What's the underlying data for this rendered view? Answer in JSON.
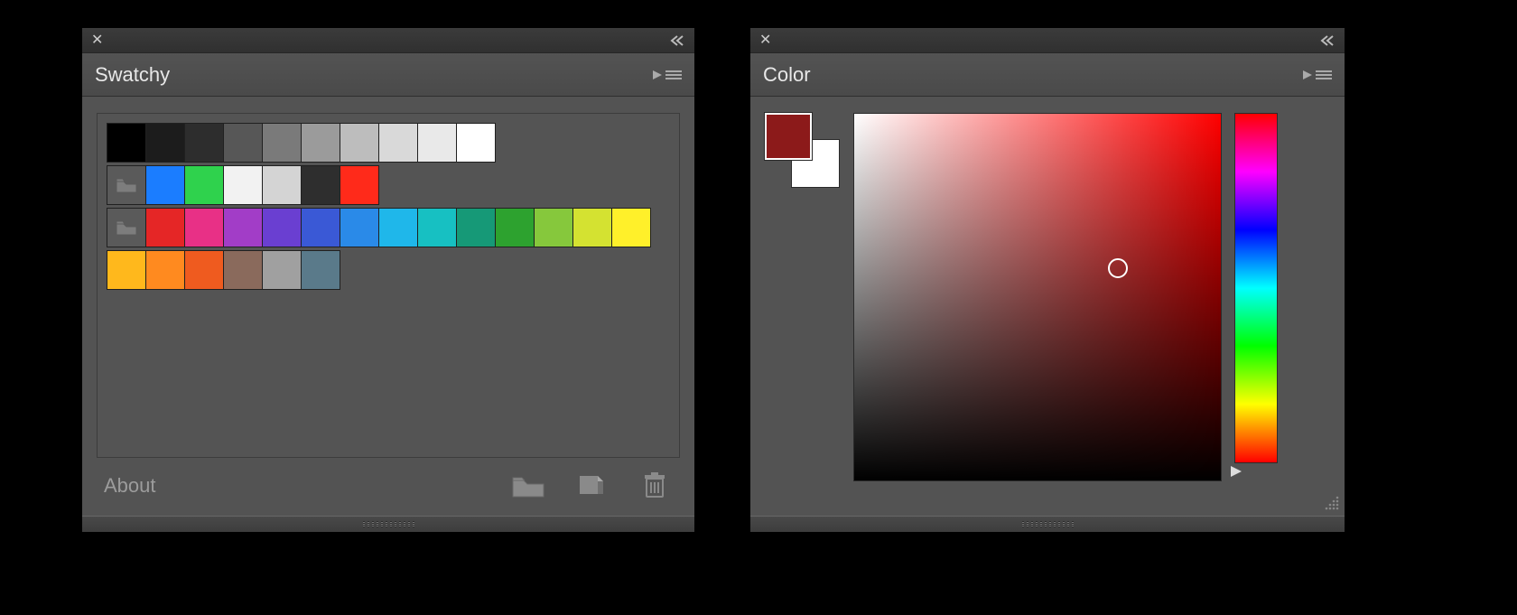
{
  "panels": {
    "swatchy": {
      "title": "Swatchy",
      "about_label": "About",
      "rows": [
        {
          "folder": false,
          "colors": [
            "#000000",
            "#1c1c1c",
            "#2d2d2d",
            "#575757",
            "#7a7a7a",
            "#9b9b9b",
            "#bdbdbd",
            "#d9d9d9",
            "#e9e9e9",
            "#ffffff"
          ]
        },
        {
          "folder": true,
          "colors": [
            "#1b7dff",
            "#2fd24d",
            "#f2f2f2",
            "#d4d4d4",
            "#2e2e2e",
            "#ff2a1a"
          ]
        },
        {
          "folder": true,
          "colors": [
            "#e52626",
            "#e83086",
            "#a23dc7",
            "#6a3fd1",
            "#3a59d6",
            "#2a8ae8",
            "#1fb7ea",
            "#17c0c2",
            "#169977",
            "#2da22f",
            "#86c83c",
            "#d4e231",
            "#fff02a"
          ]
        },
        {
          "folder": false,
          "colors": [
            "#ffb81c",
            "#ff8a1f",
            "#ef5b1f",
            "#8a6a5c",
            "#a0a0a0",
            "#5a7a8a"
          ]
        }
      ],
      "footer_icons": [
        "folder-icon",
        "new-swatch-icon",
        "trash-icon"
      ]
    },
    "color": {
      "title": "Color",
      "foreground": "#8c1a1a",
      "background": "#ffffff",
      "hue_base": "#ff0000",
      "picker_pos": {
        "x_pct": 72,
        "y_pct": 42
      }
    }
  }
}
